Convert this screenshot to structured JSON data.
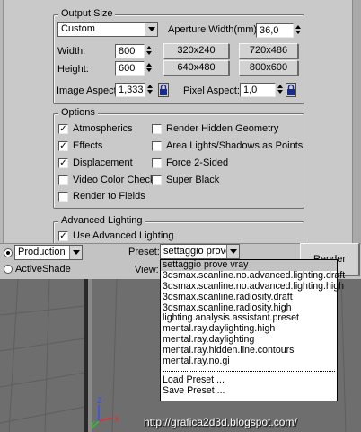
{
  "output_size": {
    "title": "Output Size",
    "preset_value": "Custom",
    "aperture_label": "Aperture Width(mm):",
    "aperture_value": "36,0",
    "width_label": "Width:",
    "width_value": "800",
    "height_label": "Height:",
    "height_value": "600",
    "res_buttons": [
      "320x240",
      "720x486",
      "640x480",
      "800x600"
    ],
    "image_aspect_label": "Image Aspect:",
    "image_aspect_value": "1,333",
    "pixel_aspect_label": "Pixel Aspect:",
    "pixel_aspect_value": "1,0"
  },
  "options": {
    "title": "Options",
    "items": [
      {
        "label": "Atmospherics",
        "checked": true
      },
      {
        "label": "Render Hidden Geometry",
        "checked": false
      },
      {
        "label": "Effects",
        "checked": true
      },
      {
        "label": "Area Lights/Shadows as Points",
        "checked": false
      },
      {
        "label": "Displacement",
        "checked": true
      },
      {
        "label": "Force 2-Sided",
        "checked": false
      },
      {
        "label": "Video Color Check",
        "checked": false
      },
      {
        "label": "Super Black",
        "checked": false
      },
      {
        "label": "Render to Fields",
        "checked": false
      }
    ]
  },
  "advanced_lighting": {
    "title": "Advanced Lighting",
    "partial_label": "Use Advanced Lighting",
    "checked": true
  },
  "render_bar": {
    "mode_production": "Production",
    "mode_activeshade": "ActiveShade",
    "preset_label": "Preset:",
    "preset_value": "settaggio prove",
    "view_label": "View:",
    "render_button": "Render"
  },
  "preset_list": {
    "items": [
      "settaggio prove vray",
      "3dsmax.scanline.no.advanced.lighting.draft",
      "3dsmax.scanline.no.advanced.lighting.high",
      "3dsmax.scanline.radiosity.draft",
      "3dsmax.scanline.radiosity.high",
      "lighting.analysis.assistant.preset",
      "mental.ray.daylighting.high",
      "mental.ray.daylighting",
      "mental.ray.hidden.line.contours",
      "mental.ray.no.gi"
    ],
    "actions": [
      "Load Preset ...",
      "Save Preset ..."
    ],
    "selected_index": 0
  },
  "viewport": {
    "axis_x": "X",
    "axis_y": "Y",
    "axis_z": "Z"
  },
  "watermark": "http://grafica2d3d.blogspot.com/",
  "colors": {
    "panel": "#c9c9c9",
    "viewport": "#6e6e6e",
    "axis_x": "#e03030",
    "axis_y": "#30c030",
    "axis_z": "#3050ff"
  }
}
